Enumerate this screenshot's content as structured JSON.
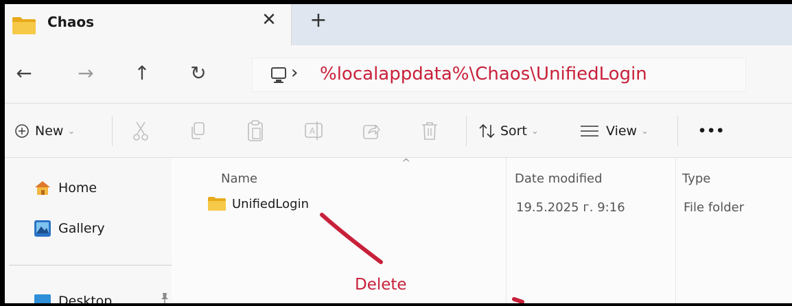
{
  "window": {
    "tab_title": "Chaos",
    "close_tab_glyph": "✕",
    "new_tab_glyph": "+"
  },
  "nav": {
    "back_glyph": "←",
    "forward_glyph": "→",
    "up_glyph": "↑",
    "refresh_glyph": "↻",
    "breadcrumb_chevron": "›",
    "address_path": "%localappdata%\\Chaos\\UnifiedLogin",
    "address_color": "#c8203a"
  },
  "commandbar": {
    "new_label": "New",
    "sort_label": "Sort",
    "view_label": "View",
    "more_label": "•••",
    "icons": [
      "add-circle-icon",
      "cut-icon",
      "copy-icon",
      "paste-icon",
      "rename-icon",
      "share-icon",
      "delete-icon",
      "sort-icon",
      "view-icon",
      "more-icon"
    ]
  },
  "sidebar": {
    "items": [
      {
        "label": "Home",
        "icon": "home-icon"
      },
      {
        "label": "Gallery",
        "icon": "gallery-icon"
      },
      {
        "label": "Desktop",
        "icon": "desktop-icon"
      }
    ]
  },
  "content": {
    "columns": {
      "name": "Name",
      "date": "Date modified",
      "type": "Type"
    },
    "rows": [
      {
        "name": "UnifiedLogin",
        "date": "19.5.2025 г. 9:16",
        "type": "File folder",
        "icon": "folder-icon"
      }
    ]
  },
  "annotation": {
    "label": "Delete",
    "color": "#c8203a"
  }
}
